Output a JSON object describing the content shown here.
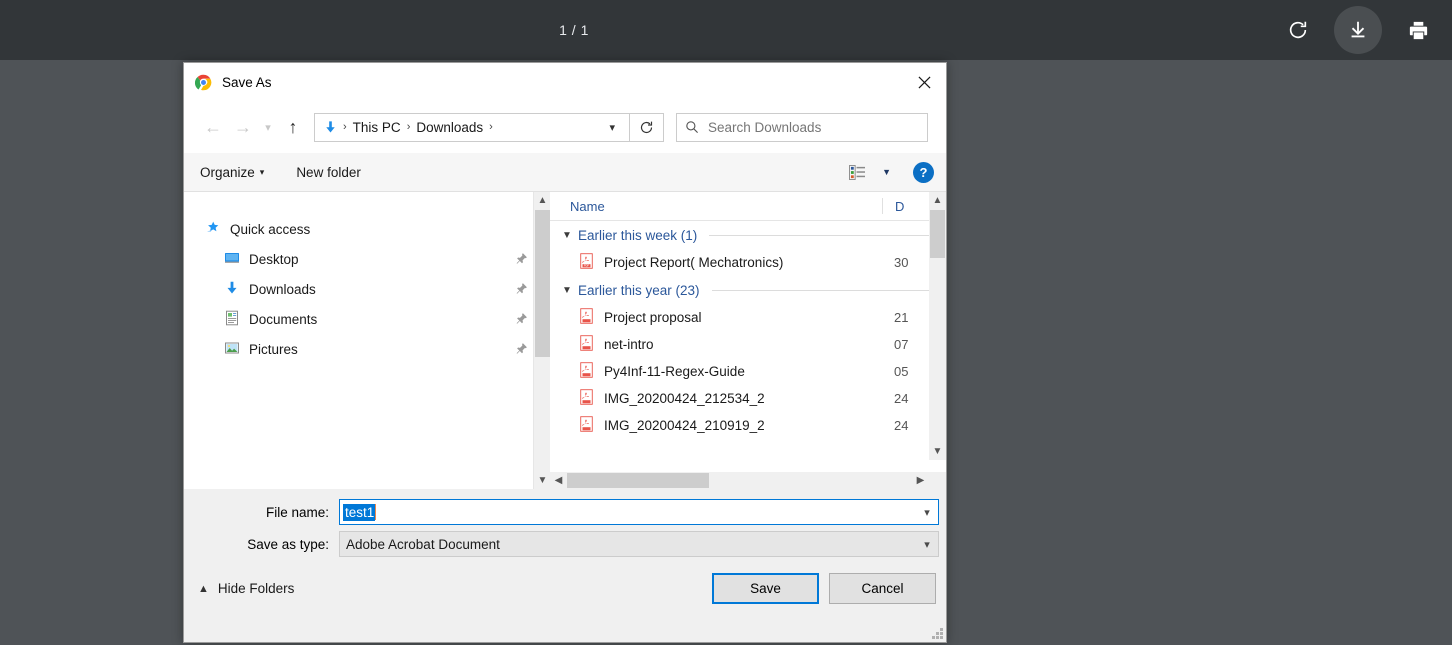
{
  "pdf_viewer": {
    "page_indicator": "1 / 1",
    "actions": [
      {
        "name": "rotate-button",
        "label": "Rotate"
      },
      {
        "name": "download-button",
        "label": "Download"
      },
      {
        "name": "print-button",
        "label": "Print"
      }
    ],
    "colors": {
      "toolbar_bg": "#323639",
      "page_bg": "#4f5357"
    }
  },
  "dialog": {
    "title": "Save As",
    "close_label": "Close",
    "navigation": {
      "back_label": "Back",
      "forward_label": "Forward",
      "recent_label": "Recent locations",
      "up_label": "Up one level",
      "breadcrumbs": [
        "This PC",
        "Downloads"
      ],
      "address_dropdown_label": "Previous locations",
      "refresh_label": "Refresh"
    },
    "search": {
      "placeholder": "Search Downloads",
      "value": ""
    },
    "command_bar": {
      "organize_label": "Organize",
      "new_folder_label": "New folder",
      "view_label": "Change your view",
      "help_label": "?"
    },
    "nav_pane": {
      "items": [
        {
          "label": "Quick access",
          "icon": "star-icon",
          "pinned": false,
          "child": false
        },
        {
          "label": "Desktop",
          "icon": "desktop-icon",
          "pinned": true,
          "child": true
        },
        {
          "label": "Downloads",
          "icon": "download-arrow-icon",
          "pinned": true,
          "child": true
        },
        {
          "label": "Documents",
          "icon": "documents-icon",
          "pinned": true,
          "child": true
        },
        {
          "label": "Pictures",
          "icon": "pictures-icon",
          "pinned": true,
          "child": true
        }
      ]
    },
    "file_list": {
      "columns": {
        "name": "Name",
        "date": "D"
      },
      "groups": [
        {
          "title": "Earlier this week (1)",
          "expanded": true,
          "files": [
            {
              "name": "Project Report( Mechatronics)",
              "date": "30",
              "icon": "pdf-icon"
            }
          ]
        },
        {
          "title": "Earlier this year (23)",
          "expanded": true,
          "files": [
            {
              "name": "Project proposal",
              "date": "21",
              "icon": "pdf-icon"
            },
            {
              "name": "net-intro",
              "date": "07",
              "icon": "pdf-icon"
            },
            {
              "name": "Py4Inf-11-Regex-Guide",
              "date": "05",
              "icon": "pdf-icon"
            },
            {
              "name": "IMG_20200424_212534_2",
              "date": "24",
              "icon": "pdf-icon"
            },
            {
              "name": "IMG_20200424_210919_2",
              "date": "24",
              "icon": "pdf-icon"
            }
          ]
        }
      ]
    },
    "form": {
      "filename_label": "File name:",
      "filename_value": "test1",
      "filetype_label": "Save as type:",
      "filetype_value": "Adobe Acrobat Document"
    },
    "footer": {
      "hide_folders_label": "Hide Folders",
      "save_label": "Save",
      "cancel_label": "Cancel"
    },
    "colors": {
      "accent": "#0078d7",
      "link": "#2b579a",
      "dialog_bg": "#f0f0f0"
    }
  }
}
